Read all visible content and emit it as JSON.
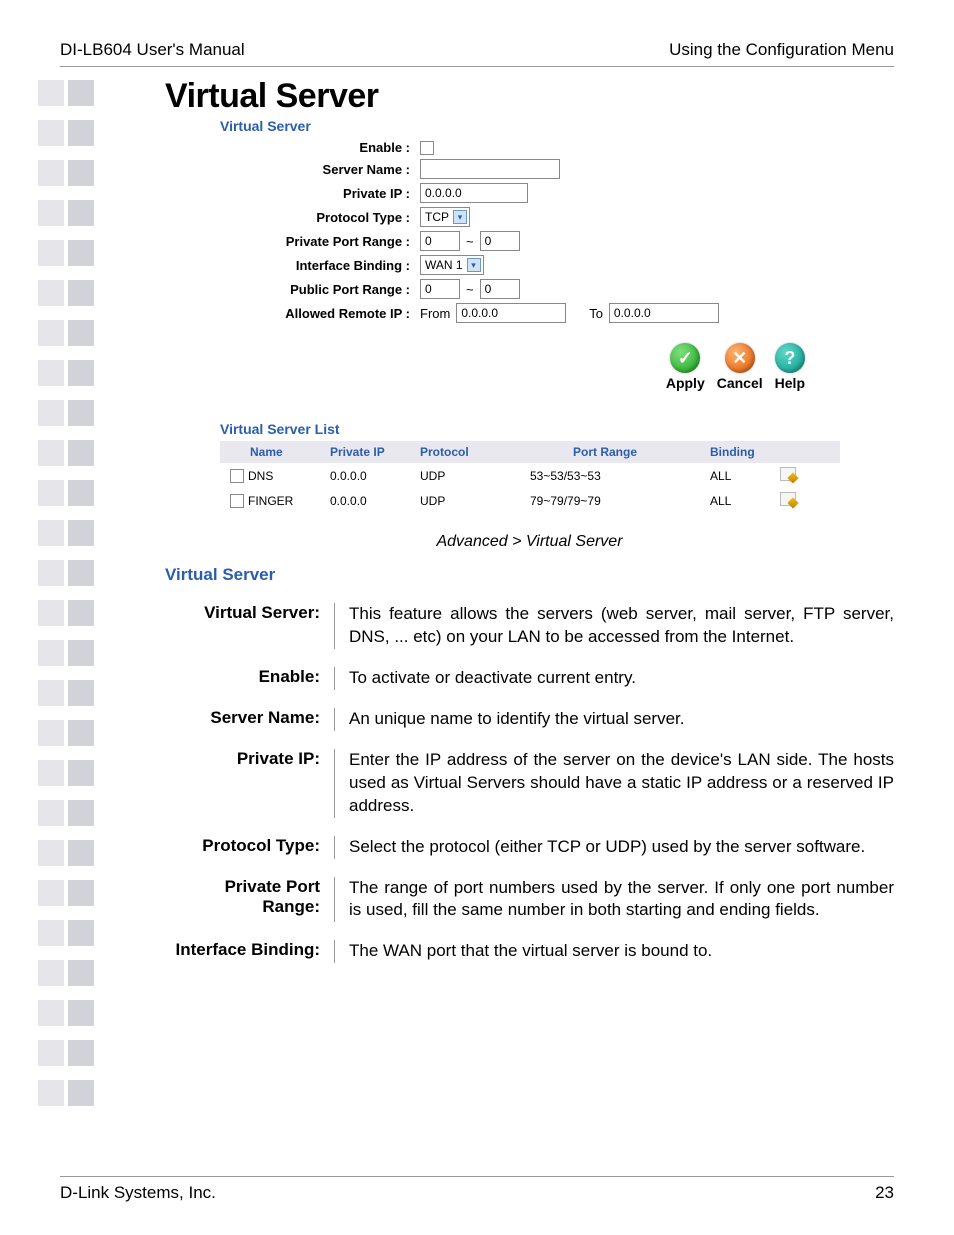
{
  "header": {
    "left": "DI-LB604 User's Manual",
    "right": "Using the Configuration Menu"
  },
  "title": "Virtual Server",
  "form": {
    "section": "Virtual Server",
    "labels": {
      "enable": "Enable :",
      "server_name": "Server Name :",
      "private_ip": "Private IP :",
      "protocol_type": "Protocol Type :",
      "private_port_range": "Private Port Range :",
      "interface_binding": "Interface Binding :",
      "public_port_range": "Public Port Range :",
      "allowed_remote_ip": "Allowed Remote IP :"
    },
    "values": {
      "server_name": "",
      "private_ip": "0.0.0.0",
      "protocol_type": "TCP",
      "private_port_from": "0",
      "private_port_to": "0",
      "interface_binding": "WAN 1",
      "public_port_from": "0",
      "public_port_to": "0",
      "allowed_from_label": "From",
      "allowed_from": "0.0.0.0",
      "allowed_to_label": "To",
      "allowed_to": "0.0.0.0",
      "tilde": "~"
    }
  },
  "buttons": {
    "apply": "Apply",
    "cancel": "Cancel",
    "help": "Help"
  },
  "list": {
    "title": "Virtual Server List",
    "headers": {
      "name": "Name",
      "private_ip": "Private IP",
      "protocol": "Protocol",
      "port_range": "Port Range",
      "binding": "Binding"
    },
    "rows": [
      {
        "name": "DNS",
        "ip": "0.0.0.0",
        "protocol": "UDP",
        "port": "53~53/53~53",
        "binding": "ALL"
      },
      {
        "name": "FINGER",
        "ip": "0.0.0.0",
        "protocol": "UDP",
        "port": "79~79/79~79",
        "binding": "ALL"
      }
    ]
  },
  "caption": "Advanced > Virtual Server",
  "doc_section": "Virtual Server",
  "definitions": [
    {
      "label": "Virtual Server:",
      "desc": "This feature allows the servers (web server, mail server, FTP server, DNS, ... etc) on your LAN to be accessed from the Internet."
    },
    {
      "label": "Enable:",
      "desc": "To activate or deactivate current entry."
    },
    {
      "label": "Server Name:",
      "desc": "An unique name to identify the virtual server."
    },
    {
      "label": "Private IP:",
      "desc": "Enter the IP address of the server on the device's LAN side. The hosts used as Virtual Servers should have a static IP address or a reserved IP address."
    },
    {
      "label": "Protocol Type:",
      "desc": "Select the protocol (either TCP or UDP) used by the server software."
    },
    {
      "label": "Private Port Range:",
      "desc": "The range of port numbers used by the server. If only one port number is used, fill the same number in both starting and ending fields."
    },
    {
      "label": "Interface Binding:",
      "desc": "The WAN port that the virtual server is bound to."
    }
  ],
  "footer": {
    "left": "D-Link Systems, Inc.",
    "right": "23"
  },
  "icons": {
    "check": "✓",
    "x": "✕",
    "q": "?"
  }
}
